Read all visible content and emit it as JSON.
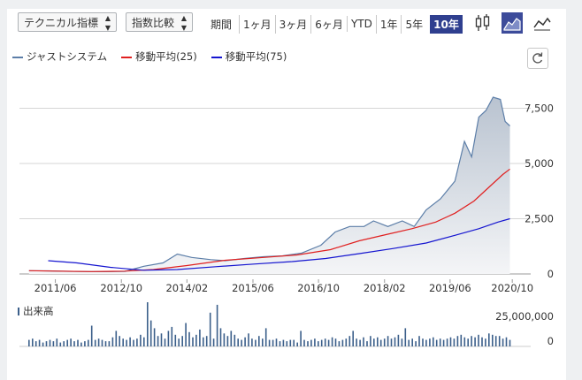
{
  "controls": {
    "technical_label": "テクニカル指標",
    "compare_label": "指数比較",
    "period_label": "期間",
    "periods": [
      "1ヶ月",
      "3ヶ月",
      "6ヶ月",
      "YTD",
      "1年",
      "5年",
      "10年"
    ],
    "active_period": "10年"
  },
  "legend": {
    "series_main": "ジャストシステム",
    "ma25": "移動平均(25)",
    "ma75": "移動平均(75)",
    "volume": "出来高"
  },
  "colors": {
    "main": "#5c7ea8",
    "ma25": "#e02020",
    "ma75": "#1515d0",
    "volume": "#3b5f8a",
    "accent": "#2f3f8f"
  },
  "chart_data": {
    "type": "area",
    "x_ticks": [
      "2011/06",
      "2012/10",
      "2014/02",
      "2015/06",
      "2016/10",
      "2018/02",
      "2019/06",
      "2020/10"
    ],
    "y_ticks": [
      "7,500",
      "5,000",
      "2,500",
      "0"
    ],
    "volume_ticks": [
      "25,000,000",
      "0"
    ],
    "ylim": [
      0,
      8000
    ],
    "series": [
      {
        "name": "ジャストシステム",
        "x": [
          2010.9,
          2011.3,
          2011.7,
          2012.1,
          2012.5,
          2012.9,
          2013.3,
          2013.7,
          2014.0,
          2014.3,
          2014.7,
          2015.0,
          2015.4,
          2015.8,
          2016.2,
          2016.6,
          2017.0,
          2017.3,
          2017.6,
          2017.9,
          2018.1,
          2018.4,
          2018.7,
          2018.95,
          2019.2,
          2019.5,
          2019.8,
          2020.0,
          2020.15,
          2020.3,
          2020.45,
          2020.6,
          2020.75,
          2020.85,
          2020.95
        ],
        "values": [
          150,
          140,
          120,
          110,
          105,
          115,
          350,
          500,
          900,
          750,
          650,
          600,
          700,
          780,
          820,
          950,
          1300,
          1900,
          2150,
          2150,
          2400,
          2150,
          2400,
          2150,
          2900,
          3400,
          4200,
          6000,
          5300,
          7100,
          7400,
          8000,
          7900,
          6900,
          6700
        ]
      },
      {
        "name": "移動平均(25)",
        "x": [
          2010.9,
          2011.5,
          2012.2,
          2012.9,
          2013.5,
          2014.2,
          2015.0,
          2015.8,
          2016.5,
          2017.2,
          2017.8,
          2018.4,
          2018.9,
          2019.4,
          2019.8,
          2020.2,
          2020.5,
          2020.8,
          2020.95
        ],
        "values": [
          150,
          130,
          110,
          130,
          200,
          380,
          620,
          750,
          860,
          1100,
          1500,
          1800,
          2050,
          2350,
          2750,
          3300,
          3900,
          4500,
          4750
        ]
      },
      {
        "name": "移動平均(75)",
        "x": [
          2011.3,
          2011.9,
          2012.6,
          2013.3,
          2014.0,
          2014.8,
          2015.6,
          2016.4,
          2017.1,
          2017.8,
          2018.5,
          2019.2,
          2019.8,
          2020.3,
          2020.7,
          2020.95
        ],
        "values": [
          600,
          500,
          300,
          170,
          200,
          330,
          450,
          560,
          700,
          920,
          1150,
          1400,
          1750,
          2050,
          2350,
          2500
        ]
      }
    ],
    "volume_max": 25000000,
    "volume": [
      5,
      6,
      4,
      5,
      3,
      4,
      5,
      4,
      6,
      3,
      4,
      5,
      6,
      4,
      5,
      3,
      4,
      5,
      16,
      5,
      6,
      5,
      4,
      4,
      7,
      12,
      8,
      6,
      5,
      7,
      5,
      6,
      9,
      7,
      34,
      20,
      14,
      8,
      10,
      6,
      12,
      15,
      9,
      6,
      8,
      18,
      11,
      7,
      9,
      13,
      7,
      8,
      26,
      6,
      32,
      14,
      10,
      8,
      12,
      9,
      6,
      5,
      7,
      10,
      6,
      5,
      8,
      6,
      14,
      5,
      5,
      6,
      4,
      5,
      4,
      5,
      5,
      3,
      12,
      5,
      4,
      5,
      6,
      4,
      5,
      6,
      5,
      7,
      6,
      4,
      5,
      6,
      8,
      12,
      6,
      5,
      7,
      4,
      8,
      6,
      7,
      5,
      6,
      8,
      6,
      7,
      9,
      6,
      14,
      5,
      6,
      4,
      8,
      6,
      5,
      6,
      7,
      5,
      6,
      5,
      6,
      7,
      6,
      8,
      9,
      7,
      6,
      8,
      7,
      9,
      7,
      6,
      10,
      9,
      8,
      8,
      6,
      7,
      5
    ]
  }
}
